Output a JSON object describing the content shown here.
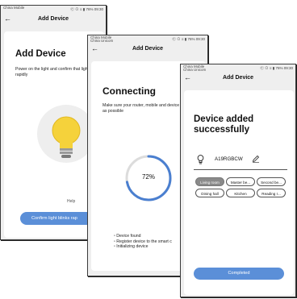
{
  "screen1": {
    "status_left": "China Mobile",
    "status_right": "Ⓒ ⊙ ≡ ▮ 76% 09:30",
    "back": "←",
    "title": "Add Device",
    "heading": "Add Device",
    "instruction": "Power on the light and confirm that light blinks rapidly",
    "help": "Help",
    "confirm_button": "Confirm light blinks rap"
  },
  "screen2": {
    "status_left": "China Mobile",
    "status_sub": "China Unicom",
    "status_right": "Ⓒ ⊙ ≡ ▮ 76% 09:30",
    "back": "←",
    "title": "Add Device",
    "heading": "Connecting",
    "instruction": "Make sure your router, mobile and device are as close as possible",
    "progress_label": "72%",
    "progress": 0.72,
    "steps": [
      "Device found",
      "Register device to the smart c",
      "Initializing device"
    ]
  },
  "screen3": {
    "status_left": "China Mobile",
    "status_sub": "China Unicom",
    "status_right": "Ⓒ ⊙ ≡ ▮ 76% 09:30",
    "back": "←",
    "title": "Add Device",
    "heading_line1": "Device added",
    "heading_line2": "successfully",
    "device_name": "A19RGBCW",
    "rooms": [
      "Living room",
      "Master be...",
      "Second be...",
      "Dining hall",
      "Kitchen",
      "Reading r..."
    ],
    "completed_button": "Completed"
  },
  "colors": {
    "accent": "#5b8fd8",
    "bulb": "#f5d23b",
    "progress": "#4a7fd0"
  }
}
